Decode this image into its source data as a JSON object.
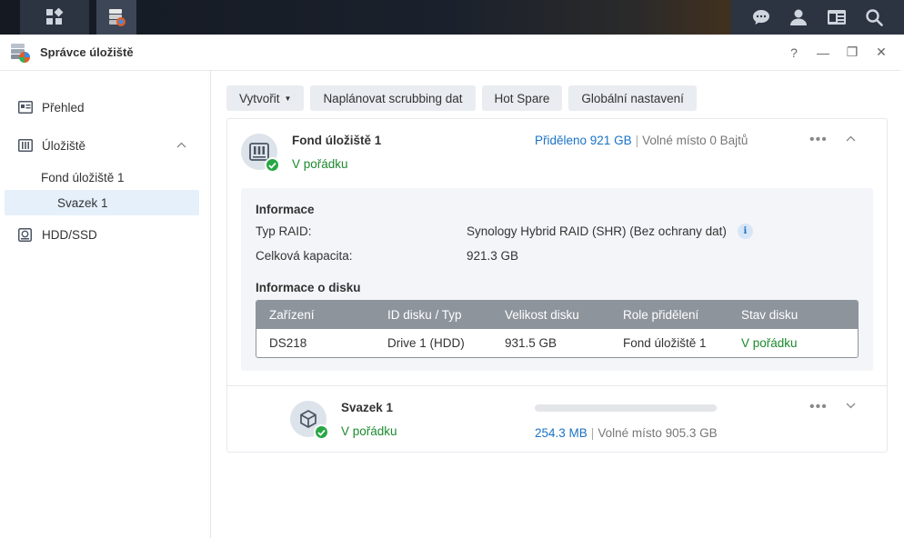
{
  "taskbar": {
    "left_icons": [
      "grid-icon",
      "storage-manager-icon"
    ],
    "right_icons": [
      "chat-icon",
      "user-icon",
      "widgets-icon",
      "search-icon"
    ]
  },
  "window": {
    "title": "Správce úložiště",
    "controls": [
      "?",
      "—",
      "❐",
      "✕"
    ]
  },
  "sidebar": {
    "items": [
      {
        "label": "Přehled",
        "icon": "overview-icon"
      },
      {
        "label": "Úložiště",
        "icon": "storage-icon"
      },
      {
        "label": "Fond úložiště 1"
      },
      {
        "label": "Svazek 1",
        "selected": true
      },
      {
        "label": "HDD/SSD",
        "icon": "hdd-icon"
      }
    ]
  },
  "toolbar": {
    "create": "Vytvořit",
    "schedule_scrubbing": "Naplánovat scrubbing dat",
    "hot_spare": "Hot Spare",
    "global_settings": "Globální nastavení"
  },
  "pool": {
    "name": "Fond úložiště 1",
    "status": "V pořádku",
    "allocated": "Přiděleno 921 GB",
    "separator": "|",
    "free": "Volné místo 0 Bajtů",
    "info": {
      "heading": "Informace",
      "raid_label": "Typ RAID:",
      "raid_value": "Synology Hybrid RAID (SHR) (Bez ochrany dat)",
      "capacity_label": "Celková kapacita:",
      "capacity_value": "921.3 GB"
    },
    "disk_info": {
      "heading": "Informace o disku",
      "columns": [
        "Zařízení",
        "ID disku / Typ",
        "Velikost disku",
        "Role přidělení",
        "Stav disku"
      ],
      "rows": [
        [
          "DS218",
          "Drive 1 (HDD)",
          "931.5 GB",
          "Fond úložiště 1",
          "V pořádku"
        ]
      ]
    }
  },
  "volume": {
    "name": "Svazek 1",
    "status": "V pořádku",
    "used": "254.3 MB",
    "separator": "|",
    "free": "Volné místo 905.3 GB",
    "usage_fraction": 0.0
  },
  "colors": {
    "accent": "#1a73c4",
    "ok": "#1b8a2e",
    "table_header": "#8e949c"
  }
}
